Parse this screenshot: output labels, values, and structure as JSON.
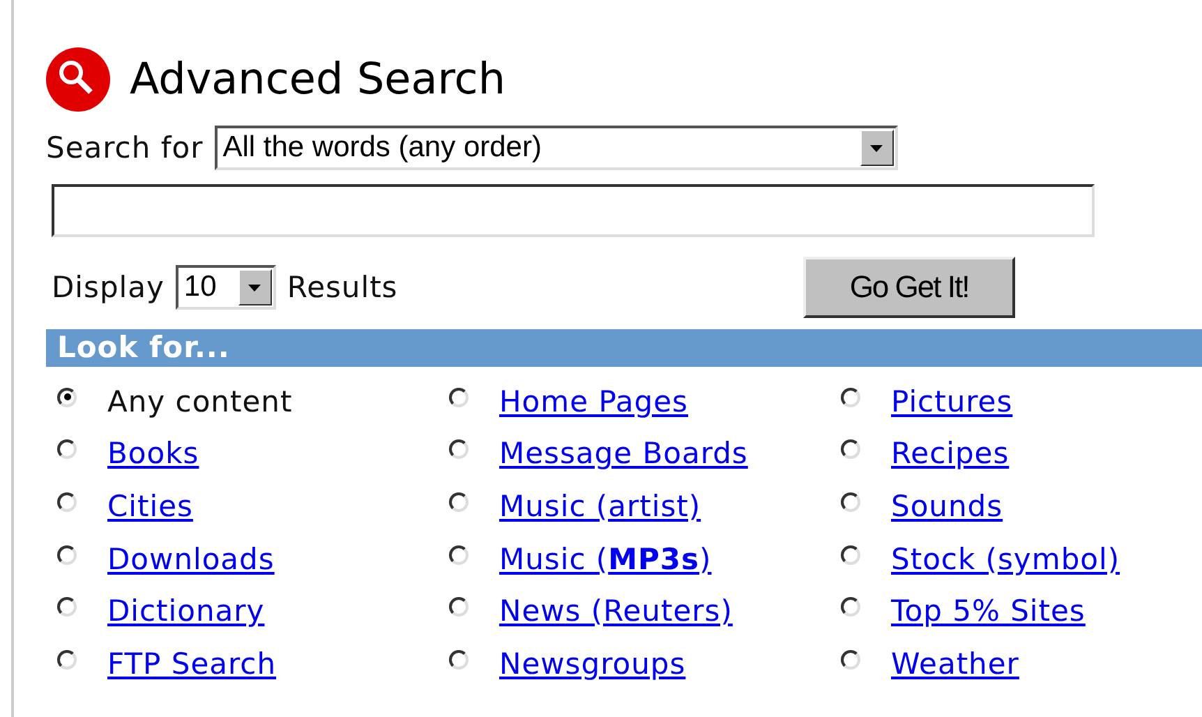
{
  "title": "Advanced Search",
  "search_for": {
    "label": "Search for",
    "value": "All the words (any order)"
  },
  "display": {
    "label": "Display",
    "value": "10",
    "suffix": "Results"
  },
  "submit": "Go Get It!",
  "look_for": {
    "heading": "Look for...",
    "options": [
      {
        "label": "Any content",
        "kind": "text",
        "selected": true
      },
      {
        "label": "Books",
        "kind": "link",
        "selected": false
      },
      {
        "label": "Cities",
        "kind": "link",
        "selected": false
      },
      {
        "label": "Downloads",
        "kind": "link",
        "selected": false
      },
      {
        "label": "Dictionary",
        "kind": "link",
        "selected": false
      },
      {
        "label": "FTP Search",
        "kind": "link",
        "selected": false
      },
      {
        "label": "Home Pages",
        "kind": "link",
        "selected": false
      },
      {
        "label": "Message Boards",
        "kind": "link",
        "selected": false
      },
      {
        "label": "Music (artist)",
        "kind": "link",
        "selected": false
      },
      {
        "label": "Music (**MP3s**)",
        "kind": "link",
        "selected": false
      },
      {
        "label": "News (Reuters)",
        "kind": "link",
        "selected": false
      },
      {
        "label": "Newsgroups",
        "kind": "link",
        "selected": false
      },
      {
        "label": "Pictures",
        "kind": "link",
        "selected": false
      },
      {
        "label": "Recipes",
        "kind": "link",
        "selected": false
      },
      {
        "label": "Sounds",
        "kind": "link",
        "selected": false
      },
      {
        "label": "Stock (symbol)",
        "kind": "link",
        "selected": false
      },
      {
        "label": "Top 5% Sites",
        "kind": "link",
        "selected": false
      },
      {
        "label": "Weather",
        "kind": "link",
        "selected": false
      }
    ]
  }
}
